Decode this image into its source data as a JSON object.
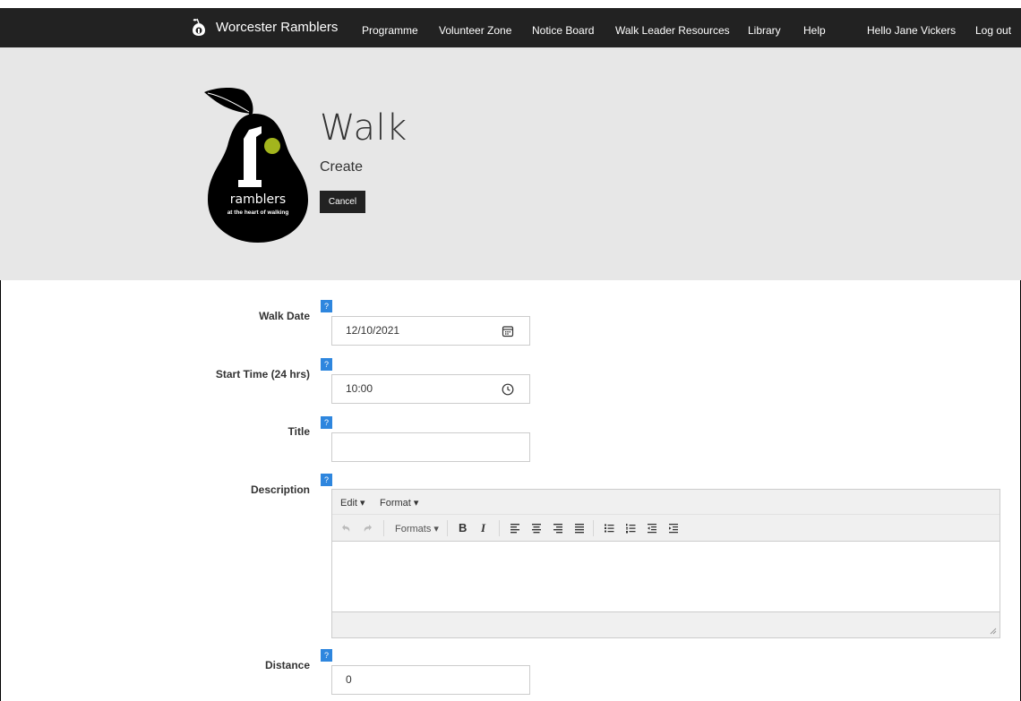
{
  "nav": {
    "brand": "Worcester Ramblers",
    "links": [
      "Programme",
      "Volunteer Zone",
      "Notice Board",
      "Walk Leader Resources",
      "Library",
      "Help"
    ],
    "greeting": "Hello Jane Vickers",
    "logout": "Log out"
  },
  "header": {
    "title": "Walk",
    "subtitle": "Create",
    "cancel_label": "Cancel",
    "logo_text": "ramblers",
    "logo_tagline": "at the heart of walking"
  },
  "form": {
    "help_label": "?",
    "walk_date": {
      "label": "Walk Date",
      "value": "12/10/2021",
      "icon": "calendar-icon"
    },
    "start_time": {
      "label": "Start Time (24 hrs)",
      "value": "10:00",
      "icon": "clock-icon"
    },
    "title": {
      "label": "Title",
      "value": ""
    },
    "description": {
      "label": "Description",
      "menu": [
        "Edit",
        "Format"
      ],
      "formats_label": "Formats",
      "bold_label": "B",
      "italic_label": "I"
    },
    "distance": {
      "label": "Distance",
      "value": "0"
    }
  },
  "colors": {
    "navbar": "#222222",
    "header_bg": "#e7e7e7",
    "help_badge": "#2e86de",
    "pear_accent": "#a3b51d"
  }
}
